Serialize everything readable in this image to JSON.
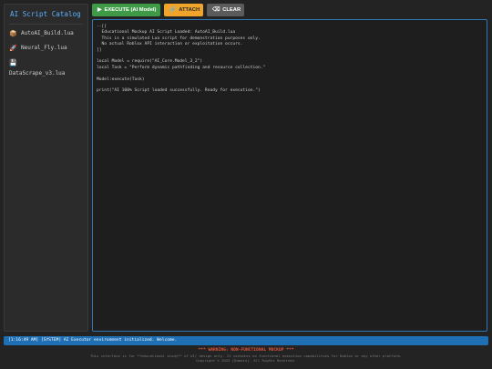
{
  "sidebar": {
    "title": "AI Script Catalog",
    "items": [
      {
        "icon": "📦",
        "label": "AutoAI_Build.lua"
      },
      {
        "icon": "🚀",
        "label": "Neural_Fly.lua"
      },
      {
        "icon": "💾",
        "label": "DataScrape_v3.lua"
      }
    ]
  },
  "toolbar": {
    "execute_icon": "▶",
    "execute_label": "EXECUTE (AI Model)",
    "attach_icon": "🔗",
    "attach_label": "ATTACH",
    "clear_icon": "⌫",
    "clear_label": "CLEAR"
  },
  "editor": {
    "code": "--[[\n  Educational Mockup AI Script Loaded: AutoAI_Build.lua\n  This is a simulated Lua script for demonstration purposes only.\n  No actual Roblox API interaction or exploitation occurs.\n]]\n\nlocal Model = require(\"AI_Core.Model_3_2\")\nlocal Task = \"Perform dynamic pathfinding and resource collection.\"\n\nModel:execute(Task)\n\nprint(\"AI 100% Script loaded successfully. Ready for execution.\")"
  },
  "console": {
    "message": "[1:16:49 AM] [SYSTEM] AI Executor environment initialized. Welcome."
  },
  "footer": {
    "warning": "*** WARNING: NON-FUNCTIONAL MOCKUP ***",
    "disclaimer_line1": "This interface is for **educational study** of UI/ design only. It contains no functional execution capabilities for Roblox or any other platform.",
    "disclaimer_line2": "Copyright © 2025 [Domain]. All Rights Reserved."
  },
  "colors": {
    "accent": "#5ab0ff",
    "execute": "#3f9a47",
    "attach": "#f0a52a",
    "clear": "#5b5b5b",
    "console": "#1f6fb4",
    "warning": "#e0533c"
  }
}
